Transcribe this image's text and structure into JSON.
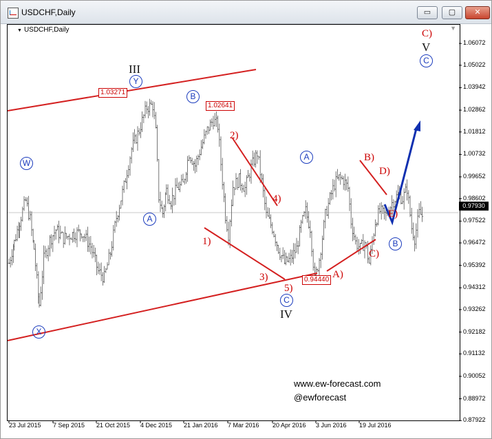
{
  "window": {
    "title": "USDCHF,Daily",
    "buttons": {
      "minimize": "▭",
      "maximize": "▢",
      "close": "✕"
    }
  },
  "chart": {
    "label": "USDCHF,Daily",
    "current_price": "0.97930"
  },
  "chart_data": {
    "type": "bar",
    "symbol": "USDCHF",
    "timeframe": "Daily",
    "ylim": [
      0.8793,
      1.0697
    ],
    "y_ticks": [
      "1.06072",
      "1.05022",
      "1.03942",
      "1.02862",
      "1.01812",
      "1.00732",
      "0.99652",
      "0.98602",
      "0.97522",
      "0.96472",
      "0.95392",
      "0.94312",
      "0.93262",
      "0.92182",
      "0.91132",
      "0.90052",
      "0.88972",
      "0.87922"
    ],
    "x_ticks": [
      "23 Jul 2015",
      "7 Sep 2015",
      "21 Oct 2015",
      "4 Dec 2015",
      "21 Jan 2016",
      "7 Mar 2016",
      "20 Apr 2016",
      "3 Jun 2016",
      "19 Jul 2016"
    ],
    "price_path": [
      [
        0,
        0.955
      ],
      [
        7,
        0.965
      ],
      [
        14,
        0.975
      ],
      [
        22,
        0.985
      ],
      [
        28,
        0.976
      ],
      [
        33,
        0.962
      ],
      [
        40,
        0.935
      ],
      [
        46,
        0.957
      ],
      [
        54,
        0.966
      ],
      [
        62,
        0.971
      ],
      [
        72,
        0.967
      ],
      [
        84,
        0.969
      ],
      [
        96,
        0.97
      ],
      [
        108,
        0.963
      ],
      [
        118,
        0.951
      ],
      [
        126,
        0.948
      ],
      [
        134,
        0.96
      ],
      [
        142,
        0.977
      ],
      [
        152,
        0.992
      ],
      [
        162,
        1.01
      ],
      [
        172,
        1.019
      ],
      [
        182,
        1.03
      ],
      [
        190,
        1.031
      ],
      [
        194,
        1.018
      ],
      [
        198,
        0.987
      ],
      [
        203,
        0.979
      ],
      [
        208,
        0.99
      ],
      [
        214,
        0.985
      ],
      [
        222,
        0.991
      ],
      [
        230,
        0.993
      ],
      [
        238,
        1.008
      ],
      [
        246,
        1.002
      ],
      [
        254,
        1.011
      ],
      [
        262,
        1.019
      ],
      [
        270,
        1.024
      ],
      [
        276,
        1.021
      ],
      [
        280,
        1.003
      ],
      [
        286,
        0.978
      ],
      [
        290,
        0.969
      ],
      [
        296,
        0.992
      ],
      [
        304,
        0.995
      ],
      [
        312,
        0.991
      ],
      [
        320,
        1.001
      ],
      [
        328,
        1.008
      ],
      [
        334,
        0.994
      ],
      [
        340,
        0.978
      ],
      [
        348,
        0.972
      ],
      [
        356,
        0.962
      ],
      [
        364,
        0.955
      ],
      [
        372,
        0.957
      ],
      [
        380,
        0.962
      ],
      [
        386,
        0.973
      ],
      [
        392,
        0.98
      ],
      [
        398,
        0.972
      ],
      [
        404,
        0.947
      ],
      [
        410,
        0.957
      ],
      [
        418,
        0.978
      ],
      [
        424,
        0.986
      ],
      [
        430,
        0.993
      ],
      [
        436,
        0.996
      ],
      [
        442,
        0.995
      ],
      [
        448,
        0.991
      ],
      [
        452,
        0.975
      ],
      [
        458,
        0.965
      ],
      [
        464,
        0.962
      ],
      [
        470,
        0.965
      ],
      [
        476,
        0.955
      ],
      [
        484,
        0.975
      ],
      [
        490,
        0.98
      ],
      [
        498,
        0.978
      ],
      [
        506,
        0.984
      ],
      [
        514,
        0.988
      ],
      [
        520,
        0.986
      ],
      [
        526,
        0.991
      ],
      [
        532,
        0.972
      ],
      [
        536,
        0.967
      ],
      [
        542,
        0.979
      ],
      [
        548,
        0.977
      ]
    ],
    "annotations": {
      "wave_labels_black": [
        "III",
        "IV",
        "V"
      ],
      "wave_labels_circled": [
        "W",
        "X",
        "Y",
        "A",
        "B",
        "C",
        "A",
        "B",
        "C"
      ],
      "wave_labels_red": [
        "1)",
        "2)",
        "3)",
        "4)",
        "5)",
        "A)",
        "B)",
        "C)",
        "D)",
        "E)",
        "C)"
      ],
      "price_boxes": [
        "1.03271",
        "1.02641",
        "0.94440"
      ]
    }
  },
  "watermark": {
    "site": "www.ew-forecast.com",
    "handle": "@ewforecast"
  }
}
